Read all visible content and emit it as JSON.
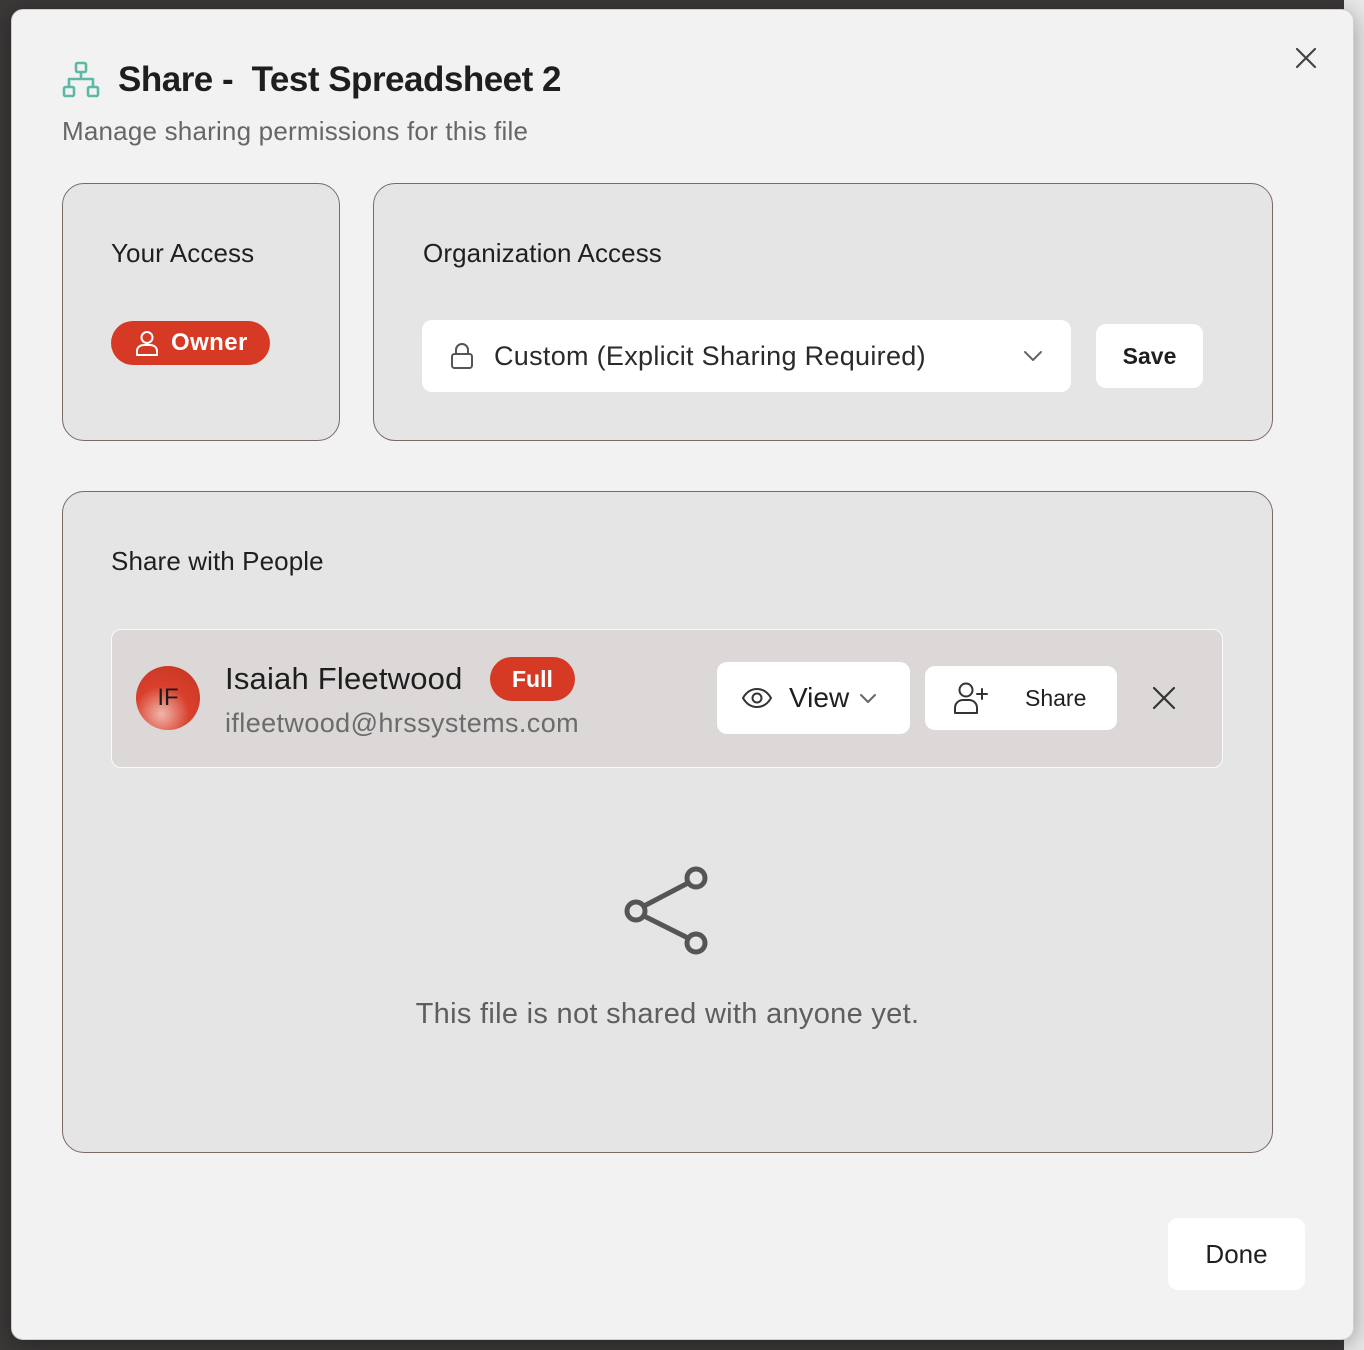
{
  "dialog": {
    "title_prefix": "Share - ",
    "file_name": "Test Spreadsheet 2",
    "subtitle": "Manage sharing permissions for this file",
    "close_icon": "close-icon",
    "done_label": "Done"
  },
  "your_access": {
    "heading": "Your Access",
    "role": "Owner",
    "role_icon": "user-icon"
  },
  "org_access": {
    "heading": "Organization Access",
    "selected": "Custom (Explicit Sharing Required)",
    "lock_icon": "lock-icon",
    "save_label": "Save"
  },
  "share_people": {
    "heading": "Share with People",
    "people": [
      {
        "initials": "IF",
        "name": "Isaiah Fleetwood",
        "badge": "Full",
        "email": "ifleetwood@hrssystems.com",
        "permission": "View",
        "share_label": "Share"
      }
    ],
    "empty_message": "This file is not shared with anyone yet."
  },
  "colors": {
    "accent": "#d63a25",
    "icon_teal": "#5fb7a6"
  }
}
